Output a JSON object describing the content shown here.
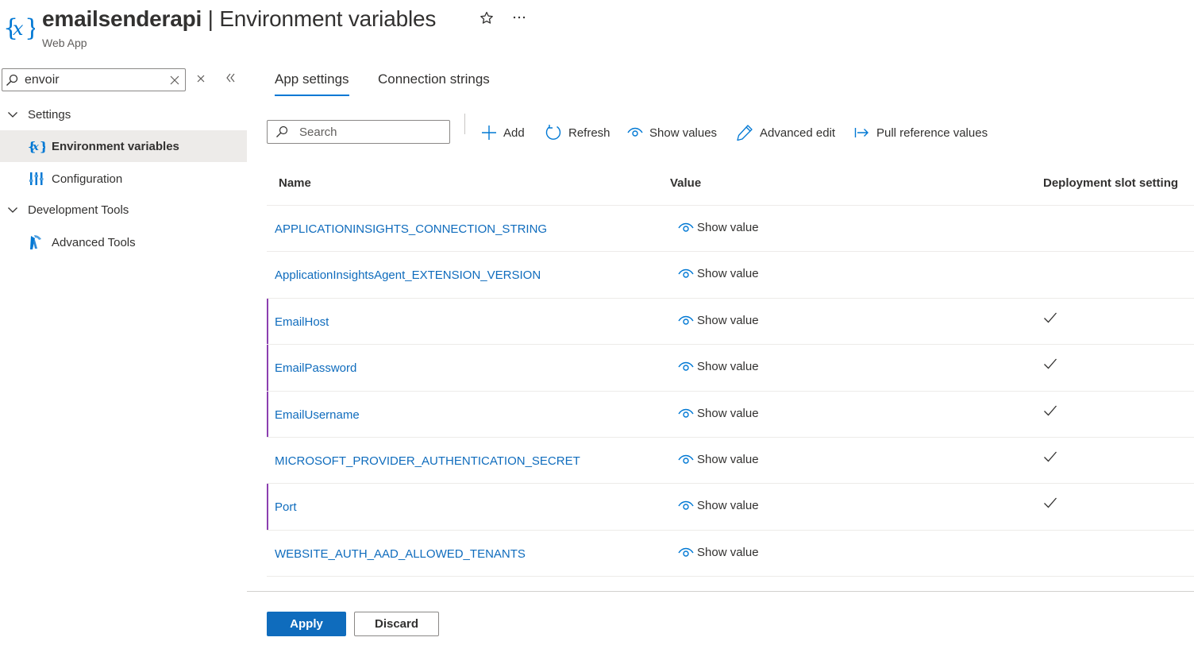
{
  "header": {
    "resource_name": "emailsenderapi",
    "separator": " | ",
    "page_name": "Environment variables",
    "subtitle": "Web App",
    "icon": "variables-icon",
    "favorite_icon": "star-icon",
    "more_icon": "more-icon"
  },
  "sidebar": {
    "search_value": "envoir",
    "groups": [
      {
        "label": "Settings",
        "items": [
          {
            "label": "Environment variables",
            "icon": "variables-icon",
            "active": true
          },
          {
            "label": "Configuration",
            "icon": "configuration-icon",
            "active": false
          }
        ]
      },
      {
        "label": "Development Tools",
        "items": [
          {
            "label": "Advanced Tools",
            "icon": "advanced-tools-icon",
            "active": false
          }
        ]
      }
    ]
  },
  "tabs": [
    {
      "label": "App settings",
      "active": true
    },
    {
      "label": "Connection strings",
      "active": false
    }
  ],
  "toolbar": {
    "search_placeholder": "Search",
    "add": "Add",
    "refresh": "Refresh",
    "show_values": "Show values",
    "advanced_edit": "Advanced edit",
    "pull_reference_values": "Pull reference values"
  },
  "table": {
    "columns": {
      "name": "Name",
      "value": "Value",
      "slot": "Deployment slot setting"
    },
    "rows": [
      {
        "name": "APPLICATIONINSIGHTS_CONNECTION_STRING",
        "value": "Show value",
        "slot_setting": false,
        "modified": false
      },
      {
        "name": "ApplicationInsightsAgent_EXTENSION_VERSION",
        "value": "Show value",
        "slot_setting": false,
        "modified": false
      },
      {
        "name": "EmailHost",
        "value": "Show value",
        "slot_setting": true,
        "modified": true
      },
      {
        "name": "EmailPassword",
        "value": "Show value",
        "slot_setting": true,
        "modified": true
      },
      {
        "name": "EmailUsername",
        "value": "Show value",
        "slot_setting": true,
        "modified": true
      },
      {
        "name": "MICROSOFT_PROVIDER_AUTHENTICATION_SECRET",
        "value": "Show value",
        "slot_setting": true,
        "modified": false
      },
      {
        "name": "Port",
        "value": "Show value",
        "slot_setting": true,
        "modified": true
      },
      {
        "name": "WEBSITE_AUTH_AAD_ALLOWED_TENANTS",
        "value": "Show value",
        "slot_setting": false,
        "modified": false
      }
    ]
  },
  "footer": {
    "apply": "Apply",
    "discard": "Discard"
  },
  "colors": {
    "accent": "#0078d4",
    "link": "#0f6cbd",
    "modified_marker": "#8b3fb0",
    "active_nav_bg": "#edebe9"
  }
}
